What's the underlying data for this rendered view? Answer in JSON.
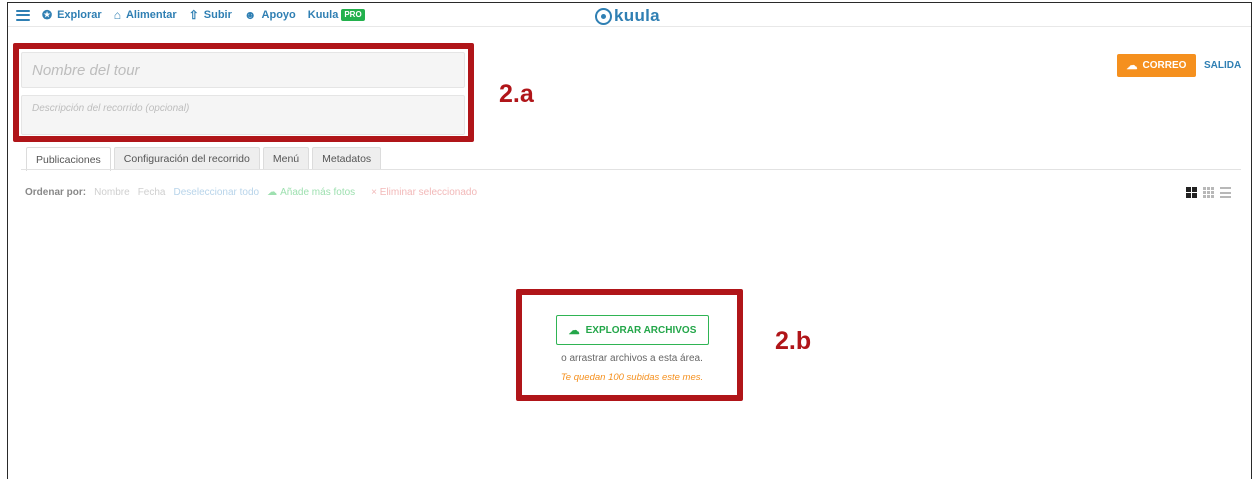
{
  "nav": {
    "items": [
      {
        "icon": "compass-icon",
        "label": "Explorar"
      },
      {
        "icon": "home-icon",
        "label": "Alimentar"
      },
      {
        "icon": "upload-icon",
        "label": "Subir"
      },
      {
        "icon": "support-icon",
        "label": "Apoyo"
      },
      {
        "icon": "",
        "label": "Kuula"
      }
    ],
    "pro_badge": "PRO"
  },
  "logo": {
    "text": "kuula",
    "color": "#2f7fb3"
  },
  "form": {
    "tour_name_placeholder": "Nombre del tour",
    "tour_description_placeholder": "Descripción del recorrido (opcional)"
  },
  "actions": {
    "correo_label": "CORREO",
    "salida_label": "SALIDA",
    "accent_orange": "#f5901e"
  },
  "tabs": [
    {
      "label": "Publicaciones",
      "active": true
    },
    {
      "label": "Configuración del recorrido",
      "active": false
    },
    {
      "label": "Menú",
      "active": false
    },
    {
      "label": "Metadatos",
      "active": false
    }
  ],
  "toolbar": {
    "order_label": "Ordenar por:",
    "sort_name": "Nombre",
    "sort_date": "Fecha",
    "deselect_all": "Deseleccionar todo",
    "add_photos": "Añade más fotos",
    "remove_selected": "× Eliminar seleccionado"
  },
  "upload": {
    "explore_button": "EXPLORAR ARCHIVOS",
    "drag_text": "o arrastrar archivos a esta área.",
    "quota_text": "Te quedan 100 subidas este mes.",
    "accent_green": "#23a649"
  },
  "annotations": {
    "label_a": "2.a",
    "label_b": "2.b",
    "highlight_color": "#b01519"
  }
}
